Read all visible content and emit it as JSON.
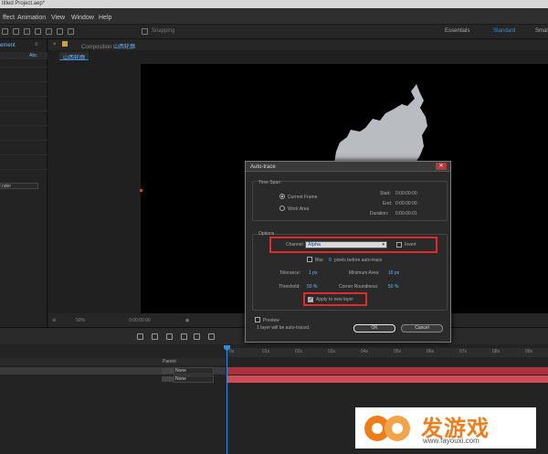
{
  "window": {
    "title": "titled Project.aep*"
  },
  "menu": {
    "items": [
      "ffect",
      "Animation",
      "View",
      "Window",
      "Help"
    ]
  },
  "toolbar": {
    "snapping": "Snapping",
    "workspaces": [
      "Essentials",
      "Standard",
      "Smal"
    ],
    "active_workspace": "Standard"
  },
  "left_panel": {
    "tab": "ement",
    "col": "Abc",
    "dropdown": "nder"
  },
  "composition": {
    "panel_title_prefix": "Composition",
    "panel_title_name": "山西轮廓",
    "tab": "山西轮廓",
    "zoom": "50%",
    "timecode": "0:00:00:00"
  },
  "timeline": {
    "parent_header": "Parent",
    "layers": [
      {
        "parent": "None",
        "color": "#c0424b"
      },
      {
        "parent": "None",
        "color": "#e05560"
      }
    ],
    "ruler": [
      "0s",
      "01s",
      "02s",
      "03s",
      "04s",
      "05s",
      "06s",
      "07s",
      "08s",
      "09s"
    ]
  },
  "dialog": {
    "title": "Auto-trace",
    "time_span": {
      "label": "Time Span",
      "current_frame": "Current Frame",
      "work_area": "Work Area",
      "start_label": "Start:",
      "start": "0:00:00:00",
      "end_label": "End:",
      "end": "0:00:00:00",
      "duration_label": "Duration:",
      "duration": "0:00:00:01"
    },
    "options": {
      "label": "Options",
      "channel_label": "Channel:",
      "channel_value": "Alpha",
      "invert": "Invert",
      "blur_label": "Blur",
      "blur_value": "0",
      "blur_suffix": "pixels before auto-trace",
      "tolerance_label": "Tolerance:",
      "tolerance_value": "1 px",
      "min_area_label": "Minimum Area:",
      "min_area_value": "10 px",
      "threshold_label": "Threshold:",
      "threshold_value": "50 %",
      "corner_label": "Corner Roundness:",
      "corner_value": "50 %",
      "apply_label": "Apply to new layer"
    },
    "preview": "Preview",
    "status": "1 layer will be auto-traced.",
    "ok": "OK",
    "cancel": "Cancel"
  },
  "watermark": {
    "text": "发游戏",
    "url": "www.fayouxi.com"
  },
  "colors": {
    "accent": "#2b8fe0",
    "highlight": "#e12b2b",
    "shape": "#b9bcc1"
  }
}
